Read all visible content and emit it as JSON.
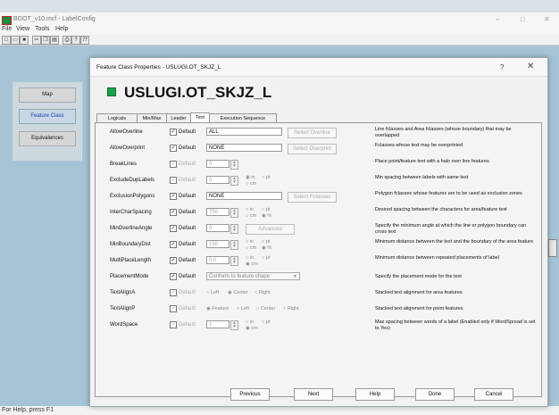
{
  "window": {
    "title": "BOOT_v10.mcf - LabelConfig",
    "minimize": "–",
    "maximize": "□",
    "close": "✕"
  },
  "menu": [
    "File",
    "View",
    "Tools",
    "Help"
  ],
  "toolbar_icons": [
    "new-icon",
    "open-icon",
    "save-icon",
    "cut-icon",
    "copy-icon",
    "paste-icon",
    "print-icon",
    "help-icon",
    "whatsthis-icon"
  ],
  "status": "For Help, press F1",
  "dialog": {
    "title": "Feature Class Properties - USLUGI.OT_SKJZ_L",
    "help": "?",
    "close": "✕",
    "heading": "USLUGI.OT_SKJZ_L",
    "nav": [
      "Map",
      "Feature Class",
      "Equivalences"
    ],
    "tabs": [
      "Logicals",
      "Min/Max",
      "Leader",
      "Text",
      "Execution Sequence"
    ],
    "default_label": "Default",
    "rows": [
      {
        "name": "AllowOverline",
        "value": "ALL",
        "button": "Select Overline",
        "desc": "Line fclasses and Area fclasses (whose boundary) that may be overlapped"
      },
      {
        "name": "AllowOverprint",
        "value": "NONE",
        "button": "Select Overprint",
        "desc": "Fclasses whose text may be overprinted"
      },
      {
        "name": "BreakLines",
        "value": "0",
        "desc": "Place point/feature text with a halo over line features"
      },
      {
        "name": "ExcludeDupLabels",
        "value": "0",
        "units": [
          "in",
          "pt",
          "cm"
        ],
        "desc": "Min spacing between labels with same text"
      },
      {
        "name": "ExclusionPolygons",
        "value": "NONE",
        "button": "Select Fclasses",
        "desc": "Polygon fclasses whose features are to be used as exclusion zones"
      },
      {
        "name": "InterCharSpacing",
        "value": "750",
        "units": [
          "in",
          "pt",
          "cm",
          "%"
        ],
        "desc": "Desired spacing between the characters for area/feature text"
      },
      {
        "name": "MinOverlineAngle",
        "value": "0",
        "button": "Advanced",
        "desc": "Specify the minimum angle at which the line or polygon boundary can cross text"
      },
      {
        "name": "MinBoundaryDist",
        "value": "150",
        "units": [
          "in",
          "pt",
          "cm",
          "%"
        ],
        "desc": "Minimum distance between the text and the boundary of the area feature"
      },
      {
        "name": "MultiPlaceLength",
        "value": "5.0",
        "units": [
          "in",
          "pt",
          "cm"
        ],
        "desc": "Minimum distance between repeated placements of label"
      },
      {
        "name": "PlacementMode",
        "value": "Conform to feature shape",
        "desc": "Specify the placement mode for the text"
      },
      {
        "name": "TextAlignA",
        "options": [
          "Left",
          "Center",
          "Right"
        ],
        "desc": "Stacked text alignment for area features"
      },
      {
        "name": "TextAlignP",
        "options": [
          "Feature",
          "Left",
          "Center",
          "Right"
        ],
        "desc": "Stacked text alignment for point features"
      },
      {
        "name": "WordSpace",
        "value": "1",
        "units": [
          "in",
          "pt",
          "cm"
        ],
        "desc": "Max spacing between words of a label (Enabled only if WordSpread is set to Yes)"
      }
    ],
    "buttons": {
      "previous": "Previous",
      "next": "Next",
      "help": "Help",
      "done": "Done",
      "cancel": "Cancel"
    }
  }
}
